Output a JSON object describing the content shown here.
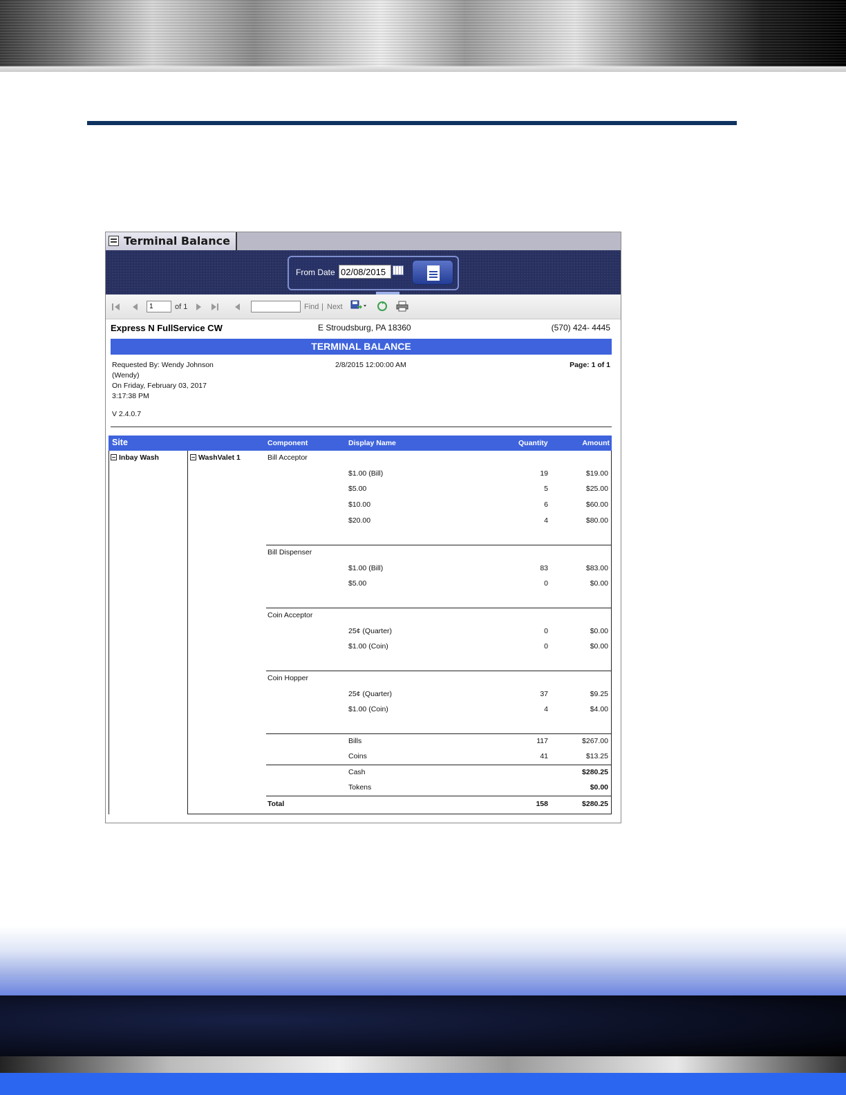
{
  "window": {
    "tab_title": "Terminal Balance",
    "param_label": "From Date",
    "from_date": "02/08/2015",
    "toolbar": {
      "page_value": "1",
      "page_of": "of 1",
      "find_label": "Find",
      "next_label": "Next",
      "separator": "|"
    }
  },
  "report": {
    "company": "Express N FullService CW",
    "city": "E Stroudsburg, PA 18360",
    "phone": "(570) 424- 4445",
    "title": "TERMINAL BALANCE",
    "requested_by_1": "Requested By: Wendy Johnson",
    "requested_by_2": "(Wendy)",
    "requested_on": "On Friday, February 03, 2017",
    "requested_time": "3:17:38 PM",
    "date": "2/8/2015 12:00:00 AM",
    "page": "Page: 1 of 1",
    "version": "V 2.4.0.7",
    "columns": {
      "site": "Site",
      "component": "Component",
      "display_name": "Display Name",
      "quantity": "Quantity",
      "amount": "Amount"
    },
    "site_name": "Inbay Wash",
    "terminal_name": "WashValet 1",
    "groups": [
      {
        "component": "Bill Acceptor",
        "rows": [
          {
            "name": "$1.00 (Bill)",
            "qty": "19",
            "amount": "$19.00"
          },
          {
            "name": "$5.00",
            "qty": "5",
            "amount": "$25.00"
          },
          {
            "name": "$10.00",
            "qty": "6",
            "amount": "$60.00"
          },
          {
            "name": "$20.00",
            "qty": "4",
            "amount": "$80.00"
          }
        ]
      },
      {
        "component": "Bill Dispenser",
        "rows": [
          {
            "name": "$1.00 (Bill)",
            "qty": "83",
            "amount": "$83.00"
          },
          {
            "name": "$5.00",
            "qty": "0",
            "amount": "$0.00"
          }
        ]
      },
      {
        "component": "Coin Acceptor",
        "rows": [
          {
            "name": "25¢ (Quarter)",
            "qty": "0",
            "amount": "$0.00"
          },
          {
            "name": "$1.00 (Coin)",
            "qty": "0",
            "amount": "$0.00"
          }
        ]
      },
      {
        "component": "Coin Hopper",
        "rows": [
          {
            "name": "25¢ (Quarter)",
            "qty": "37",
            "amount": "$9.25"
          },
          {
            "name": "$1.00 (Coin)",
            "qty": "4",
            "amount": "$4.00"
          }
        ]
      }
    ],
    "summary": {
      "bills": {
        "label": "Bills",
        "qty": "117",
        "amount": "$267.00"
      },
      "coins": {
        "label": "Coins",
        "qty": "41",
        "amount": "$13.25"
      },
      "cash": {
        "label": "Cash",
        "amount": "$280.25"
      },
      "tokens": {
        "label": "Tokens",
        "amount": "$0.00"
      },
      "total": {
        "label": "Total",
        "qty": "158",
        "amount": "$280.25"
      }
    }
  }
}
